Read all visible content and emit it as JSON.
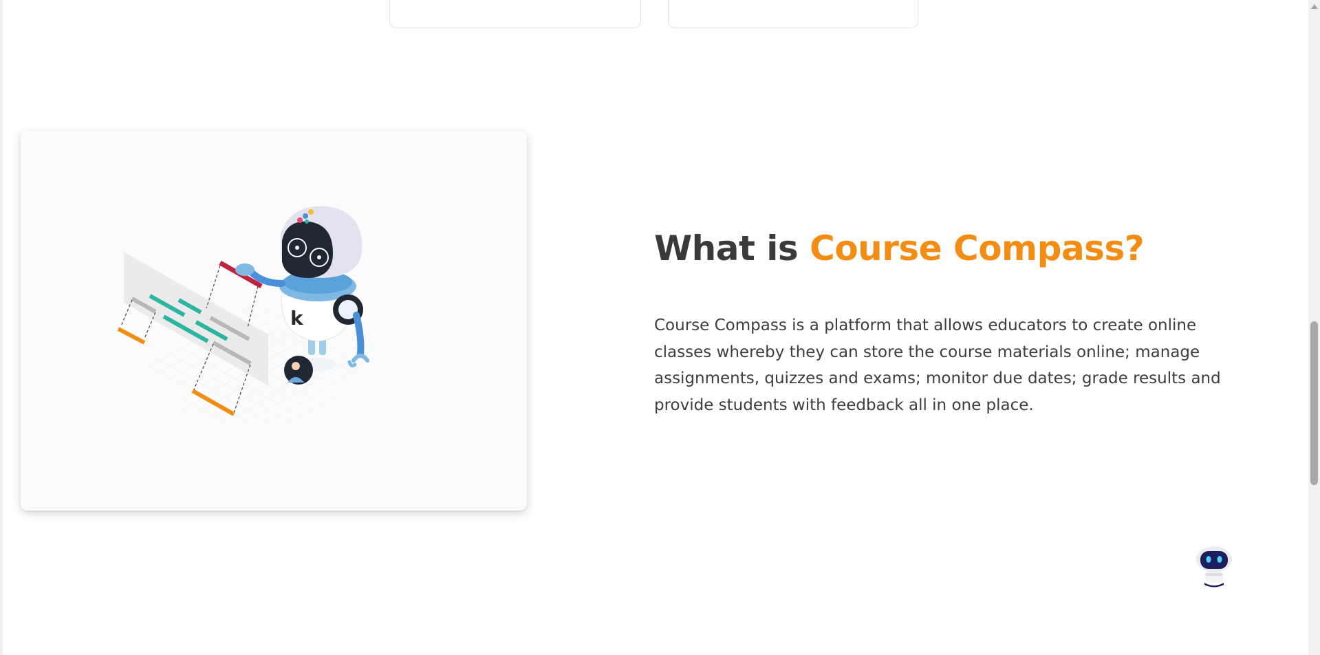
{
  "about_section": {
    "heading_prefix": "What is",
    "heading_highlight": "Course Compass?",
    "description": "Course Compass is a platform that allows educators to create online classes whereby they can store the course materials online; manage assignments, quizzes and exams; monitor due dates; grade results and provide students with feedback all in one place.",
    "illustration_icon": "robot-teacher-illustration",
    "robot_chest_letter": "k"
  },
  "chatbot": {
    "icon": "chatbot-robot-icon"
  },
  "colors": {
    "heading_dark": "#3a3a3a",
    "accent_orange": "#f28c13",
    "body_text": "#3d3d3d",
    "robot_blue": "#4a90d9",
    "teal": "#2bb5a0",
    "crimson": "#c0243d"
  }
}
